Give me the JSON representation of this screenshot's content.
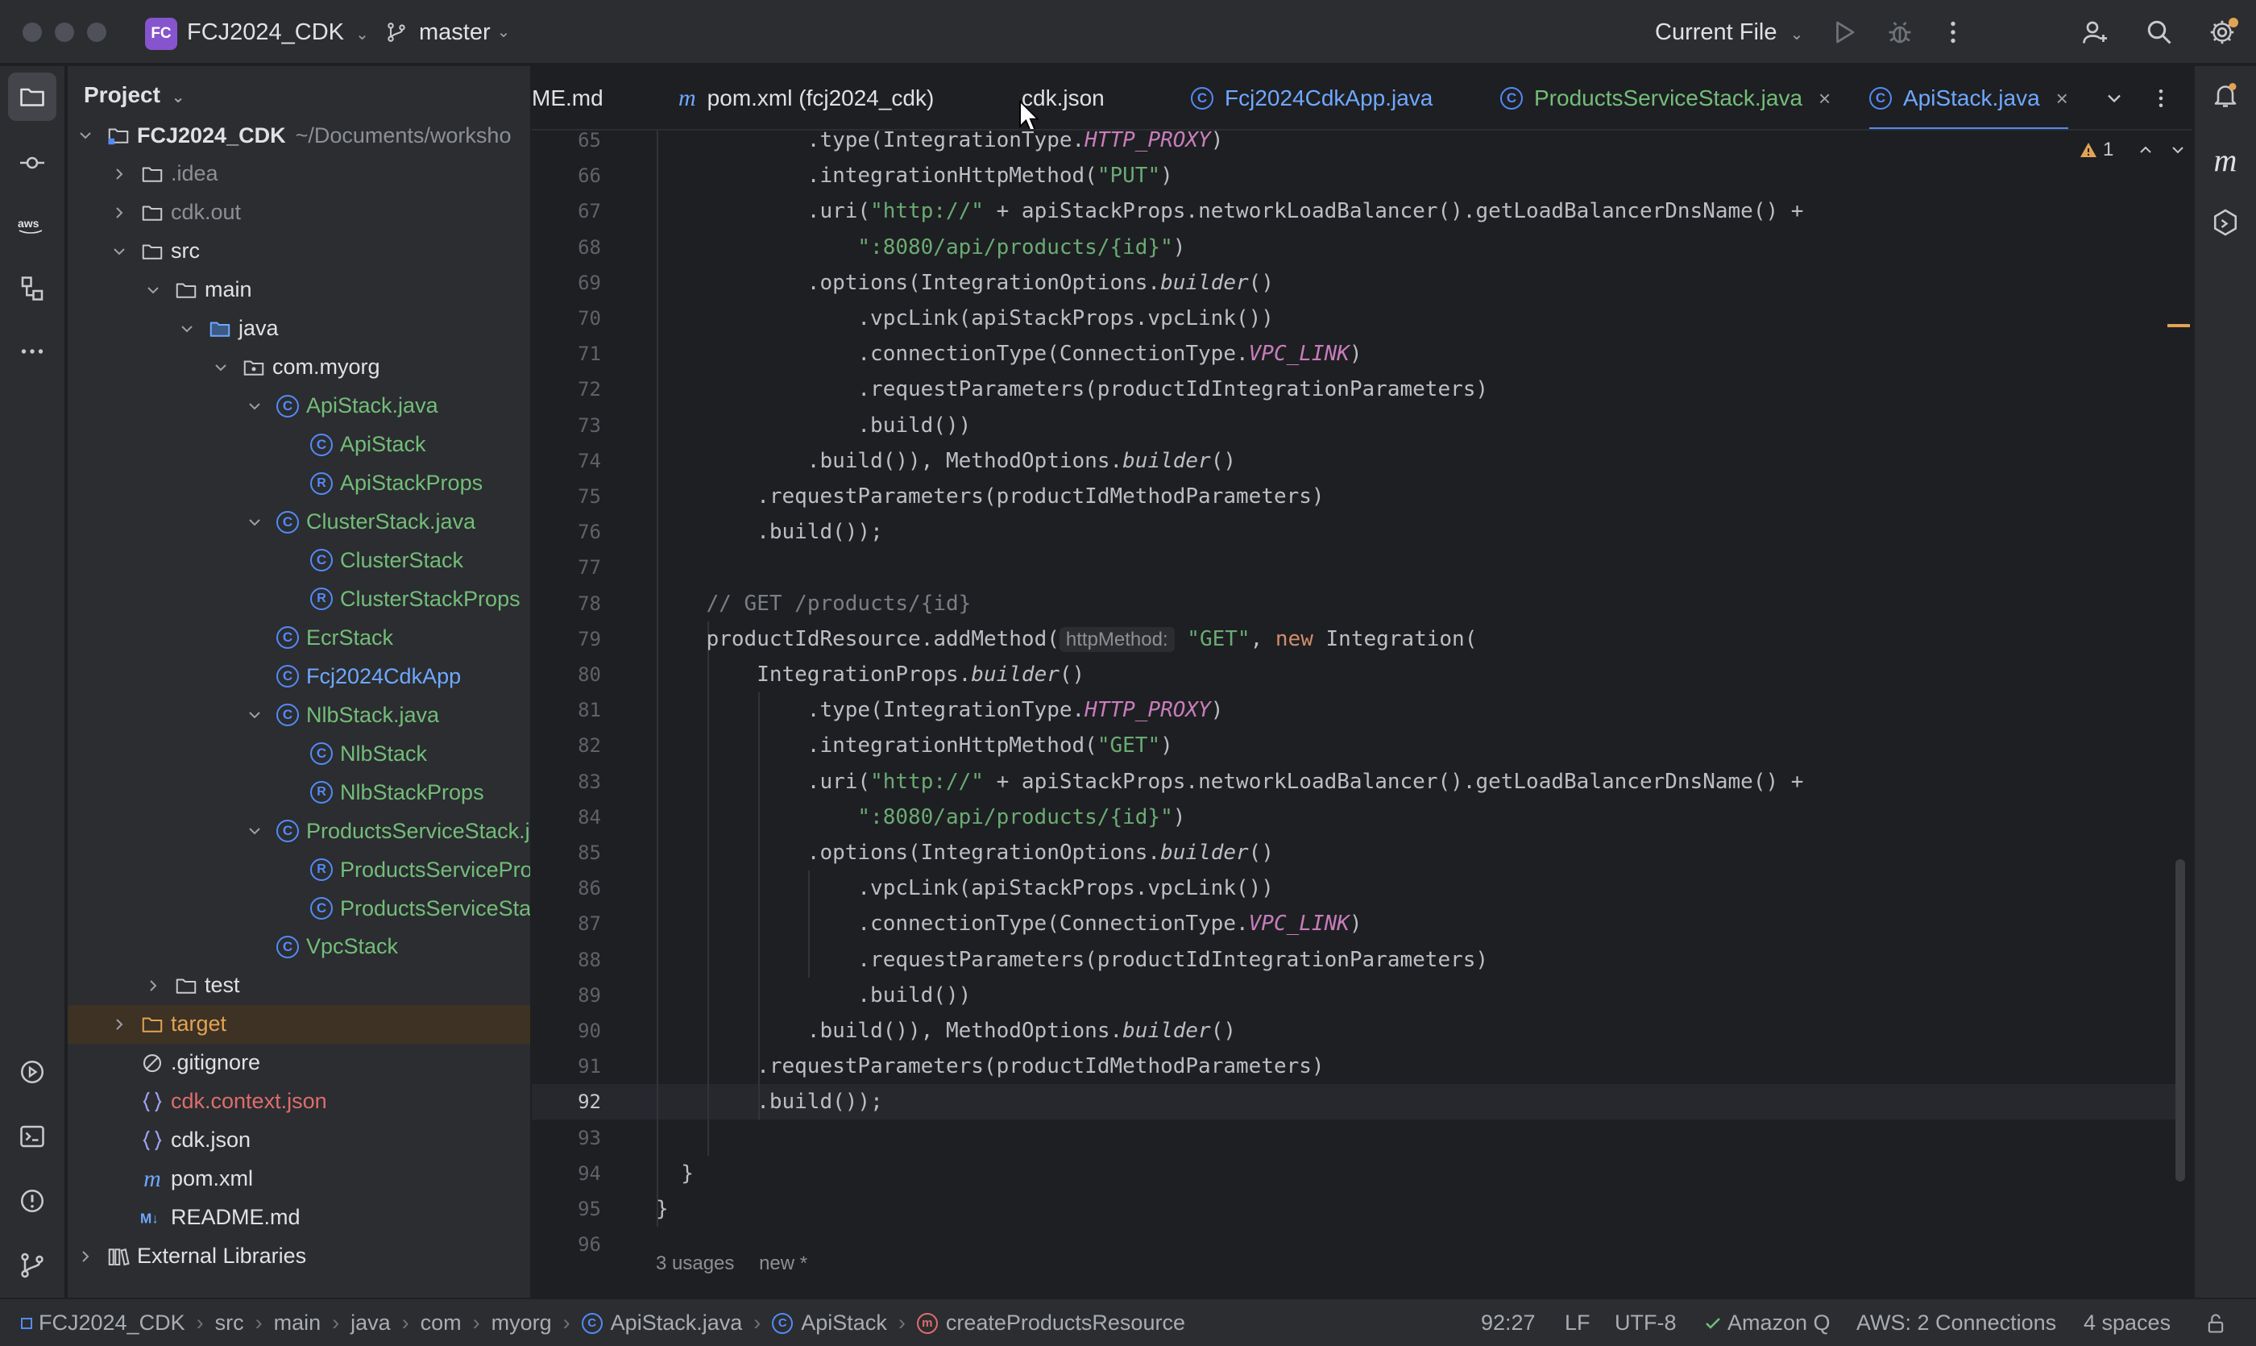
{
  "titlebar": {
    "project_badge": "FC",
    "project_name": "FCJ2024_CDK",
    "branch": "master",
    "run_config": "Current File"
  },
  "project_panel": {
    "title": "Project",
    "tree": [
      {
        "label": "FCJ2024_CDK",
        "suffix": "~/Documents/worksho",
        "depth": 0,
        "chevron": "down",
        "icon": "module",
        "color": "default",
        "bold": true
      },
      {
        "label": ".idea",
        "depth": 1,
        "chevron": "right",
        "icon": "folder",
        "color": "gray"
      },
      {
        "label": "cdk.out",
        "depth": 1,
        "chevron": "right",
        "icon": "folder",
        "color": "gray"
      },
      {
        "label": "src",
        "depth": 1,
        "chevron": "down",
        "icon": "folder",
        "color": "default"
      },
      {
        "label": "main",
        "depth": 2,
        "chevron": "down",
        "icon": "folder",
        "color": "default"
      },
      {
        "label": "java",
        "depth": 3,
        "chevron": "down",
        "icon": "folder-blue",
        "color": "default"
      },
      {
        "label": "com.myorg",
        "depth": 4,
        "chevron": "down",
        "icon": "package",
        "color": "default"
      },
      {
        "label": "ApiStack.java",
        "depth": 5,
        "chevron": "down",
        "icon": "class",
        "color": "green"
      },
      {
        "label": "ApiStack",
        "depth": 6,
        "chevron": "none",
        "icon": "class",
        "color": "green"
      },
      {
        "label": "ApiStackProps",
        "depth": 6,
        "chevron": "none",
        "icon": "record",
        "color": "green"
      },
      {
        "label": "ClusterStack.java",
        "depth": 5,
        "chevron": "down",
        "icon": "class",
        "color": "green"
      },
      {
        "label": "ClusterStack",
        "depth": 6,
        "chevron": "none",
        "icon": "class",
        "color": "green"
      },
      {
        "label": "ClusterStackProps",
        "depth": 6,
        "chevron": "none",
        "icon": "record",
        "color": "green"
      },
      {
        "label": "EcrStack",
        "depth": 5,
        "chevron": "none",
        "icon": "class",
        "color": "green"
      },
      {
        "label": "Fcj2024CdkApp",
        "depth": 5,
        "chevron": "none",
        "icon": "class",
        "color": "blue"
      },
      {
        "label": "NlbStack.java",
        "depth": 5,
        "chevron": "down",
        "icon": "class",
        "color": "green"
      },
      {
        "label": "NlbStack",
        "depth": 6,
        "chevron": "none",
        "icon": "class",
        "color": "green"
      },
      {
        "label": "NlbStackProps",
        "depth": 6,
        "chevron": "none",
        "icon": "record",
        "color": "green"
      },
      {
        "label": "ProductsServiceStack.j",
        "depth": 5,
        "chevron": "down",
        "icon": "class",
        "color": "green"
      },
      {
        "label": "ProductsServicePro",
        "depth": 6,
        "chevron": "none",
        "icon": "record",
        "color": "green"
      },
      {
        "label": "ProductsServiceSta",
        "depth": 6,
        "chevron": "none",
        "icon": "class",
        "color": "green"
      },
      {
        "label": "VpcStack",
        "depth": 5,
        "chevron": "none",
        "icon": "class",
        "color": "green"
      },
      {
        "label": "test",
        "depth": 2,
        "chevron": "right",
        "icon": "folder",
        "color": "default"
      },
      {
        "label": "target",
        "depth": 1,
        "chevron": "right",
        "icon": "folder-orange",
        "color": "orange",
        "highlight": true
      },
      {
        "label": ".gitignore",
        "depth": 1,
        "chevron": "none",
        "icon": "ignore",
        "color": "default"
      },
      {
        "label": "cdk.context.json",
        "depth": 1,
        "chevron": "none",
        "icon": "json",
        "color": "red"
      },
      {
        "label": "cdk.json",
        "depth": 1,
        "chevron": "none",
        "icon": "json",
        "color": "default"
      },
      {
        "label": "pom.xml",
        "depth": 1,
        "chevron": "none",
        "icon": "maven",
        "color": "default"
      },
      {
        "label": "README.md",
        "depth": 1,
        "chevron": "none",
        "icon": "markdown",
        "color": "default"
      },
      {
        "label": "External Libraries",
        "depth": 0,
        "chevron": "right",
        "icon": "libraries",
        "color": "default"
      }
    ]
  },
  "tabs": [
    {
      "label": "ME.md",
      "icon": "none",
      "color": "default"
    },
    {
      "label": "pom.xml (fcj2024_cdk)",
      "icon": "maven",
      "color": "default"
    },
    {
      "label": "cdk.json",
      "icon": "json",
      "color": "default"
    },
    {
      "label": "Fcj2024CdkApp.java",
      "icon": "class",
      "color": "blue"
    },
    {
      "label": "ProductsServiceStack.java",
      "icon": "class",
      "color": "green",
      "close": "×"
    },
    {
      "label": "ApiStack.java",
      "icon": "class",
      "color": "blue",
      "close": "×",
      "active": true
    }
  ],
  "editor": {
    "warning_count": "1",
    "current_line": 92,
    "lines": [
      {
        "n": 65,
        "indent": 6,
        "tokens": [
          [
            ".type(IntegrationType.",
            ""
          ],
          [
            "HTTP_PROXY",
            "const"
          ],
          [
            ")",
            ""
          ]
        ]
      },
      {
        "n": 66,
        "indent": 6,
        "tokens": [
          [
            ".integrationHttpMethod(",
            ""
          ],
          [
            "\"PUT\"",
            "str"
          ],
          [
            ")",
            ""
          ]
        ]
      },
      {
        "n": 67,
        "indent": 6,
        "tokens": [
          [
            ".uri(",
            ""
          ],
          [
            "\"http://\"",
            "str"
          ],
          [
            " + apiStackProps.networkLoadBalancer().getLoadBalancerDnsName() +",
            ""
          ]
        ]
      },
      {
        "n": 68,
        "indent": 8,
        "tokens": [
          [
            "\":8080/api/products/{id}\"",
            "str"
          ],
          [
            ")",
            ""
          ]
        ]
      },
      {
        "n": 69,
        "indent": 6,
        "tokens": [
          [
            ".options(IntegrationOptions.",
            ""
          ],
          [
            "builder",
            "static"
          ],
          [
            "()",
            ""
          ]
        ]
      },
      {
        "n": 70,
        "indent": 8,
        "tokens": [
          [
            ".vpcLink(apiStackProps.vpcLink())",
            ""
          ]
        ]
      },
      {
        "n": 71,
        "indent": 8,
        "tokens": [
          [
            ".connectionType(ConnectionType.",
            ""
          ],
          [
            "VPC_LINK",
            "const"
          ],
          [
            ")",
            ""
          ]
        ]
      },
      {
        "n": 72,
        "indent": 8,
        "tokens": [
          [
            ".requestParameters(productIdIntegrationParameters)",
            ""
          ]
        ]
      },
      {
        "n": 73,
        "indent": 8,
        "tokens": [
          [
            ".build())",
            ""
          ]
        ]
      },
      {
        "n": 74,
        "indent": 6,
        "tokens": [
          [
            ".build()), MethodOptions.",
            ""
          ],
          [
            "builder",
            "static"
          ],
          [
            "()",
            ""
          ]
        ]
      },
      {
        "n": 75,
        "indent": 4,
        "tokens": [
          [
            ".requestParameters(productIdMethodParameters)",
            ""
          ]
        ]
      },
      {
        "n": 76,
        "indent": 4,
        "tokens": [
          [
            ".build());",
            ""
          ]
        ]
      },
      {
        "n": 77,
        "indent": 0,
        "tokens": []
      },
      {
        "n": 78,
        "indent": 2,
        "tokens": [
          [
            "// GET /products/{id}",
            "comment"
          ]
        ]
      },
      {
        "n": 79,
        "indent": 2,
        "tokens": [
          [
            "productIdResource.addMethod(",
            ""
          ],
          [
            "httpMethod:",
            "hint"
          ],
          [
            " ",
            ""
          ],
          [
            "\"GET\"",
            "str"
          ],
          [
            ", ",
            ""
          ],
          [
            "new",
            "kw"
          ],
          [
            " Integration(",
            ""
          ]
        ]
      },
      {
        "n": 80,
        "indent": 4,
        "tokens": [
          [
            "IntegrationProps.",
            ""
          ],
          [
            "builder",
            "static"
          ],
          [
            "()",
            ""
          ]
        ]
      },
      {
        "n": 81,
        "indent": 6,
        "tokens": [
          [
            ".type(IntegrationType.",
            ""
          ],
          [
            "HTTP_PROXY",
            "const"
          ],
          [
            ")",
            ""
          ]
        ]
      },
      {
        "n": 82,
        "indent": 6,
        "tokens": [
          [
            ".integrationHttpMethod(",
            ""
          ],
          [
            "\"GET\"",
            "str"
          ],
          [
            ")",
            ""
          ]
        ]
      },
      {
        "n": 83,
        "indent": 6,
        "tokens": [
          [
            ".uri(",
            ""
          ],
          [
            "\"http://\"",
            "str"
          ],
          [
            " + apiStackProps.networkLoadBalancer().getLoadBalancerDnsName() +",
            ""
          ]
        ]
      },
      {
        "n": 84,
        "indent": 8,
        "tokens": [
          [
            "\":8080/api/products/{id}\"",
            "str"
          ],
          [
            ")",
            ""
          ]
        ]
      },
      {
        "n": 85,
        "indent": 6,
        "tokens": [
          [
            ".options(IntegrationOptions.",
            ""
          ],
          [
            "builder",
            "static"
          ],
          [
            "()",
            ""
          ]
        ]
      },
      {
        "n": 86,
        "indent": 8,
        "tokens": [
          [
            ".vpcLink(apiStackProps.vpcLink())",
            ""
          ]
        ]
      },
      {
        "n": 87,
        "indent": 8,
        "tokens": [
          [
            ".connectionType(ConnectionType.",
            ""
          ],
          [
            "VPC_LINK",
            "const"
          ],
          [
            ")",
            ""
          ]
        ]
      },
      {
        "n": 88,
        "indent": 8,
        "tokens": [
          [
            ".requestParameters(productIdIntegrationParameters)",
            ""
          ]
        ]
      },
      {
        "n": 89,
        "indent": 8,
        "tokens": [
          [
            ".build())",
            ""
          ]
        ]
      },
      {
        "n": 90,
        "indent": 6,
        "tokens": [
          [
            ".build()), MethodOptions.",
            ""
          ],
          [
            "builder",
            "static"
          ],
          [
            "()",
            ""
          ]
        ]
      },
      {
        "n": 91,
        "indent": 4,
        "tokens": [
          [
            ".requestParameters(productIdMethodParameters)",
            ""
          ]
        ]
      },
      {
        "n": 92,
        "indent": 4,
        "tokens": [
          [
            ".build());",
            ""
          ]
        ]
      },
      {
        "n": 93,
        "indent": 0,
        "tokens": []
      },
      {
        "n": 94,
        "indent": 1,
        "tokens": [
          [
            "}",
            ""
          ]
        ]
      },
      {
        "n": 95,
        "indent": 0,
        "tokens": [
          [
            "}",
            ""
          ]
        ]
      },
      {
        "n": 96,
        "indent": 0,
        "tokens": []
      }
    ],
    "codelens": {
      "usages": "3 usages",
      "new": "new *"
    }
  },
  "statusbar": {
    "breadcrumb": [
      "FCJ2024_CDK",
      "src",
      "main",
      "java",
      "com",
      "myorg",
      "ApiStack.java",
      "ApiStack",
      "createProductsResource"
    ],
    "position": "92:27",
    "line_ending": "LF",
    "encoding": "UTF-8",
    "amazon_q": "Amazon Q",
    "aws": "AWS: 2 Connections",
    "indent": "4 spaces"
  },
  "colors": {
    "accent": "#548af7",
    "string": "#6aab73",
    "keyword": "#cf8e6d",
    "constant": "#c77dbb",
    "warning": "#e2a355"
  }
}
